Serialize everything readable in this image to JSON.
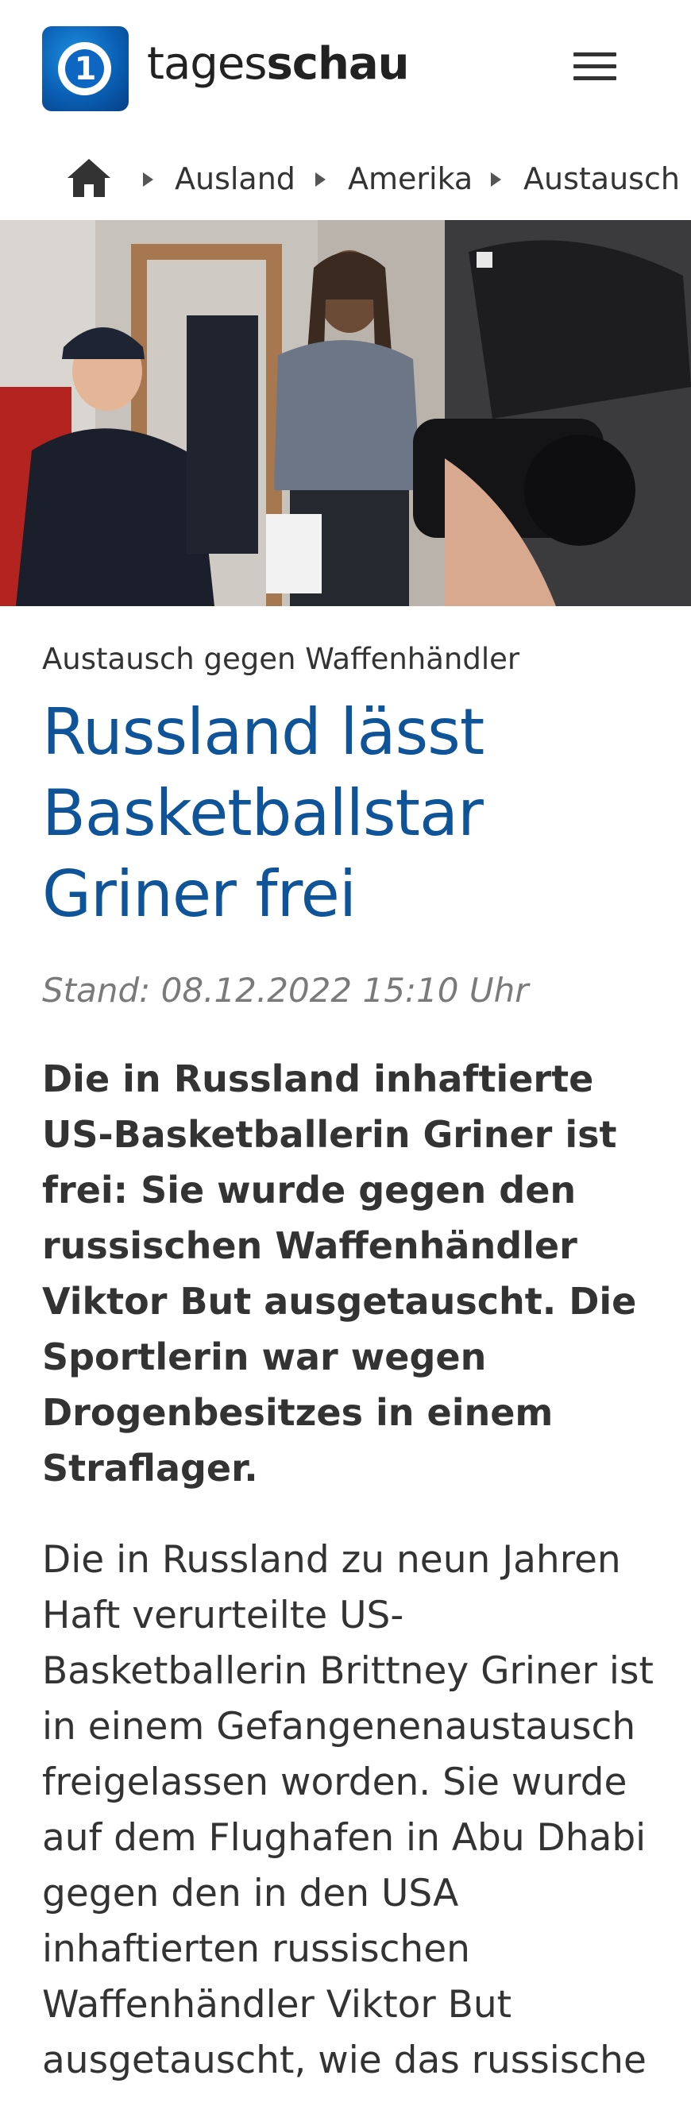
{
  "header": {
    "brand_light": "tages",
    "brand_bold": "schau",
    "logo_text": "1",
    "logo_icon": "tagesschau-logo",
    "menu_icon": "hamburger-menu-icon"
  },
  "breadcrumb": {
    "home_icon": "home-icon",
    "items": [
      "Ausland",
      "Amerika",
      "Austausch gegen Waffenhändler"
    ]
  },
  "hero_image": {
    "description_icon": "photo"
  },
  "article": {
    "kicker": "Austausch gegen Waffenhändler",
    "headline": "Russland lässt Basketballstar Griner frei",
    "stand": "Stand: 08.12.2022 15:10 Uhr",
    "lead": "Die in Russland inhaftierte US-Basketballerin Griner ist frei: Sie wurde gegen den russischen Waffenhändler Viktor But ausgetauscht. Die Sportlerin war wegen Drogenbesitzes in einem Straflager.",
    "body": "Die in Russland zu neun Jahren Haft verurteilte US-Basketballerin Brittney Griner ist in einem Gefangenenaustausch freigelassen worden. Sie wurde auf dem Flughafen in Abu Dhabi gegen den in den USA inhaftierten russischen Waffenhändler Viktor But ausgetauscht, wie das russische"
  },
  "colors": {
    "headline": "#0f5499",
    "logo": "#0a5fb4"
  }
}
